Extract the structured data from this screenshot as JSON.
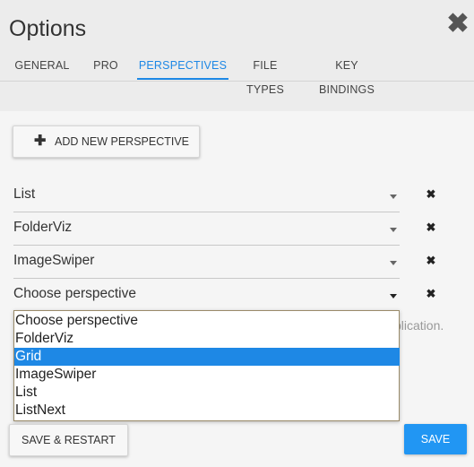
{
  "dialog": {
    "title": "Options",
    "close_glyph": "✖"
  },
  "tabs": [
    {
      "label": "GENERAL"
    },
    {
      "label": "PRO"
    },
    {
      "label": "PERSPECTIVES",
      "active": true
    },
    {
      "label": "FILE TYPES"
    },
    {
      "label": "KEY BINDINGS"
    }
  ],
  "add_perspective": {
    "icon": "plus-icon",
    "glyph": "✚",
    "label": "ADD NEW PERSPECTIVE"
  },
  "perspectives": [
    {
      "value": "List"
    },
    {
      "value": "FolderViz"
    },
    {
      "value": "ImageSwiper"
    },
    {
      "value": "Choose perspective"
    }
  ],
  "remove_glyph": "✖",
  "hint_text": "plication.",
  "dropdown": {
    "options": [
      {
        "label": "Choose perspective"
      },
      {
        "label": "FolderViz"
      },
      {
        "label": "Grid",
        "highlighted": true
      },
      {
        "label": "ImageSwiper"
      },
      {
        "label": "List"
      },
      {
        "label": "ListNext"
      }
    ]
  },
  "footer": {
    "save_restart_label": "SAVE & RESTART",
    "save_label": "SAVE"
  },
  "colors": {
    "accent": "#1e88e5",
    "save_button": "#2196f3"
  }
}
